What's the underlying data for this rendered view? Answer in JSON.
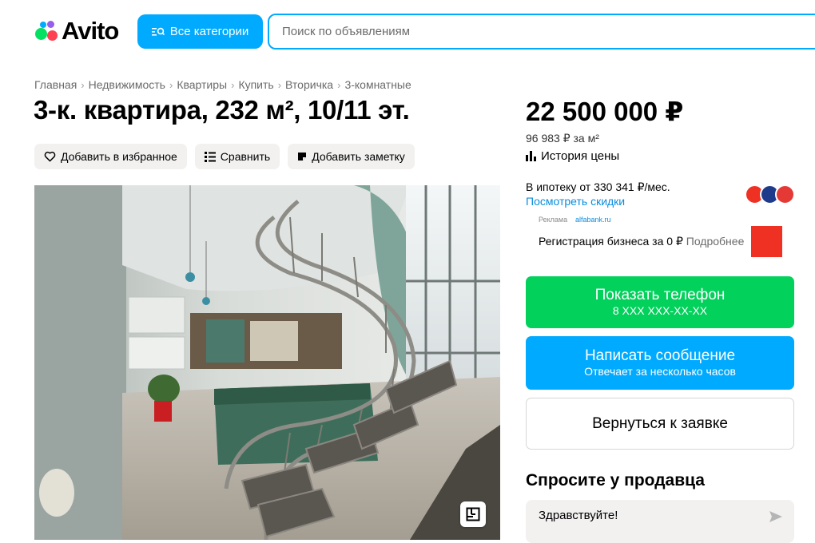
{
  "header": {
    "logo_text": "Avito",
    "categories_button": "Все категории",
    "search_placeholder": "Поиск по объявлениям"
  },
  "breadcrumbs": [
    "Главная",
    "Недвижимость",
    "Квартиры",
    "Купить",
    "Вторичка",
    "3-комнатные"
  ],
  "listing": {
    "title": "3-к. квартира, 232 м², 10/11 эт.",
    "actions": {
      "favorite": "Добавить в избранное",
      "compare": "Сравнить",
      "note": "Добавить заметку"
    }
  },
  "sidebar": {
    "price": "22 500 000 ₽",
    "price_per_meter": "96 983 ₽ за м²",
    "price_history": "История цены",
    "mortgage": "В ипотеку от 330 341 ₽/мес.",
    "discounts": "Посмотреть скидки",
    "ad": {
      "label": "Реклама",
      "source": "alfabank.ru",
      "text": "Регистрация бизнеса за 0 ₽",
      "more": "Подробнее"
    },
    "show_phone": {
      "label": "Показать телефон",
      "number": "8 XXX XXX-XX-XX"
    },
    "send_message": {
      "label": "Написать сообщение",
      "note": "Отвечает за несколько часов"
    },
    "back_button": "Вернуться к заявке",
    "ask_seller": {
      "title": "Спросите у продавца",
      "message": "Здравствуйте!"
    }
  },
  "colors": {
    "accent_blue": "#00aaff",
    "accent_green": "#02d15c",
    "link_blue": "#0a8ddc"
  }
}
